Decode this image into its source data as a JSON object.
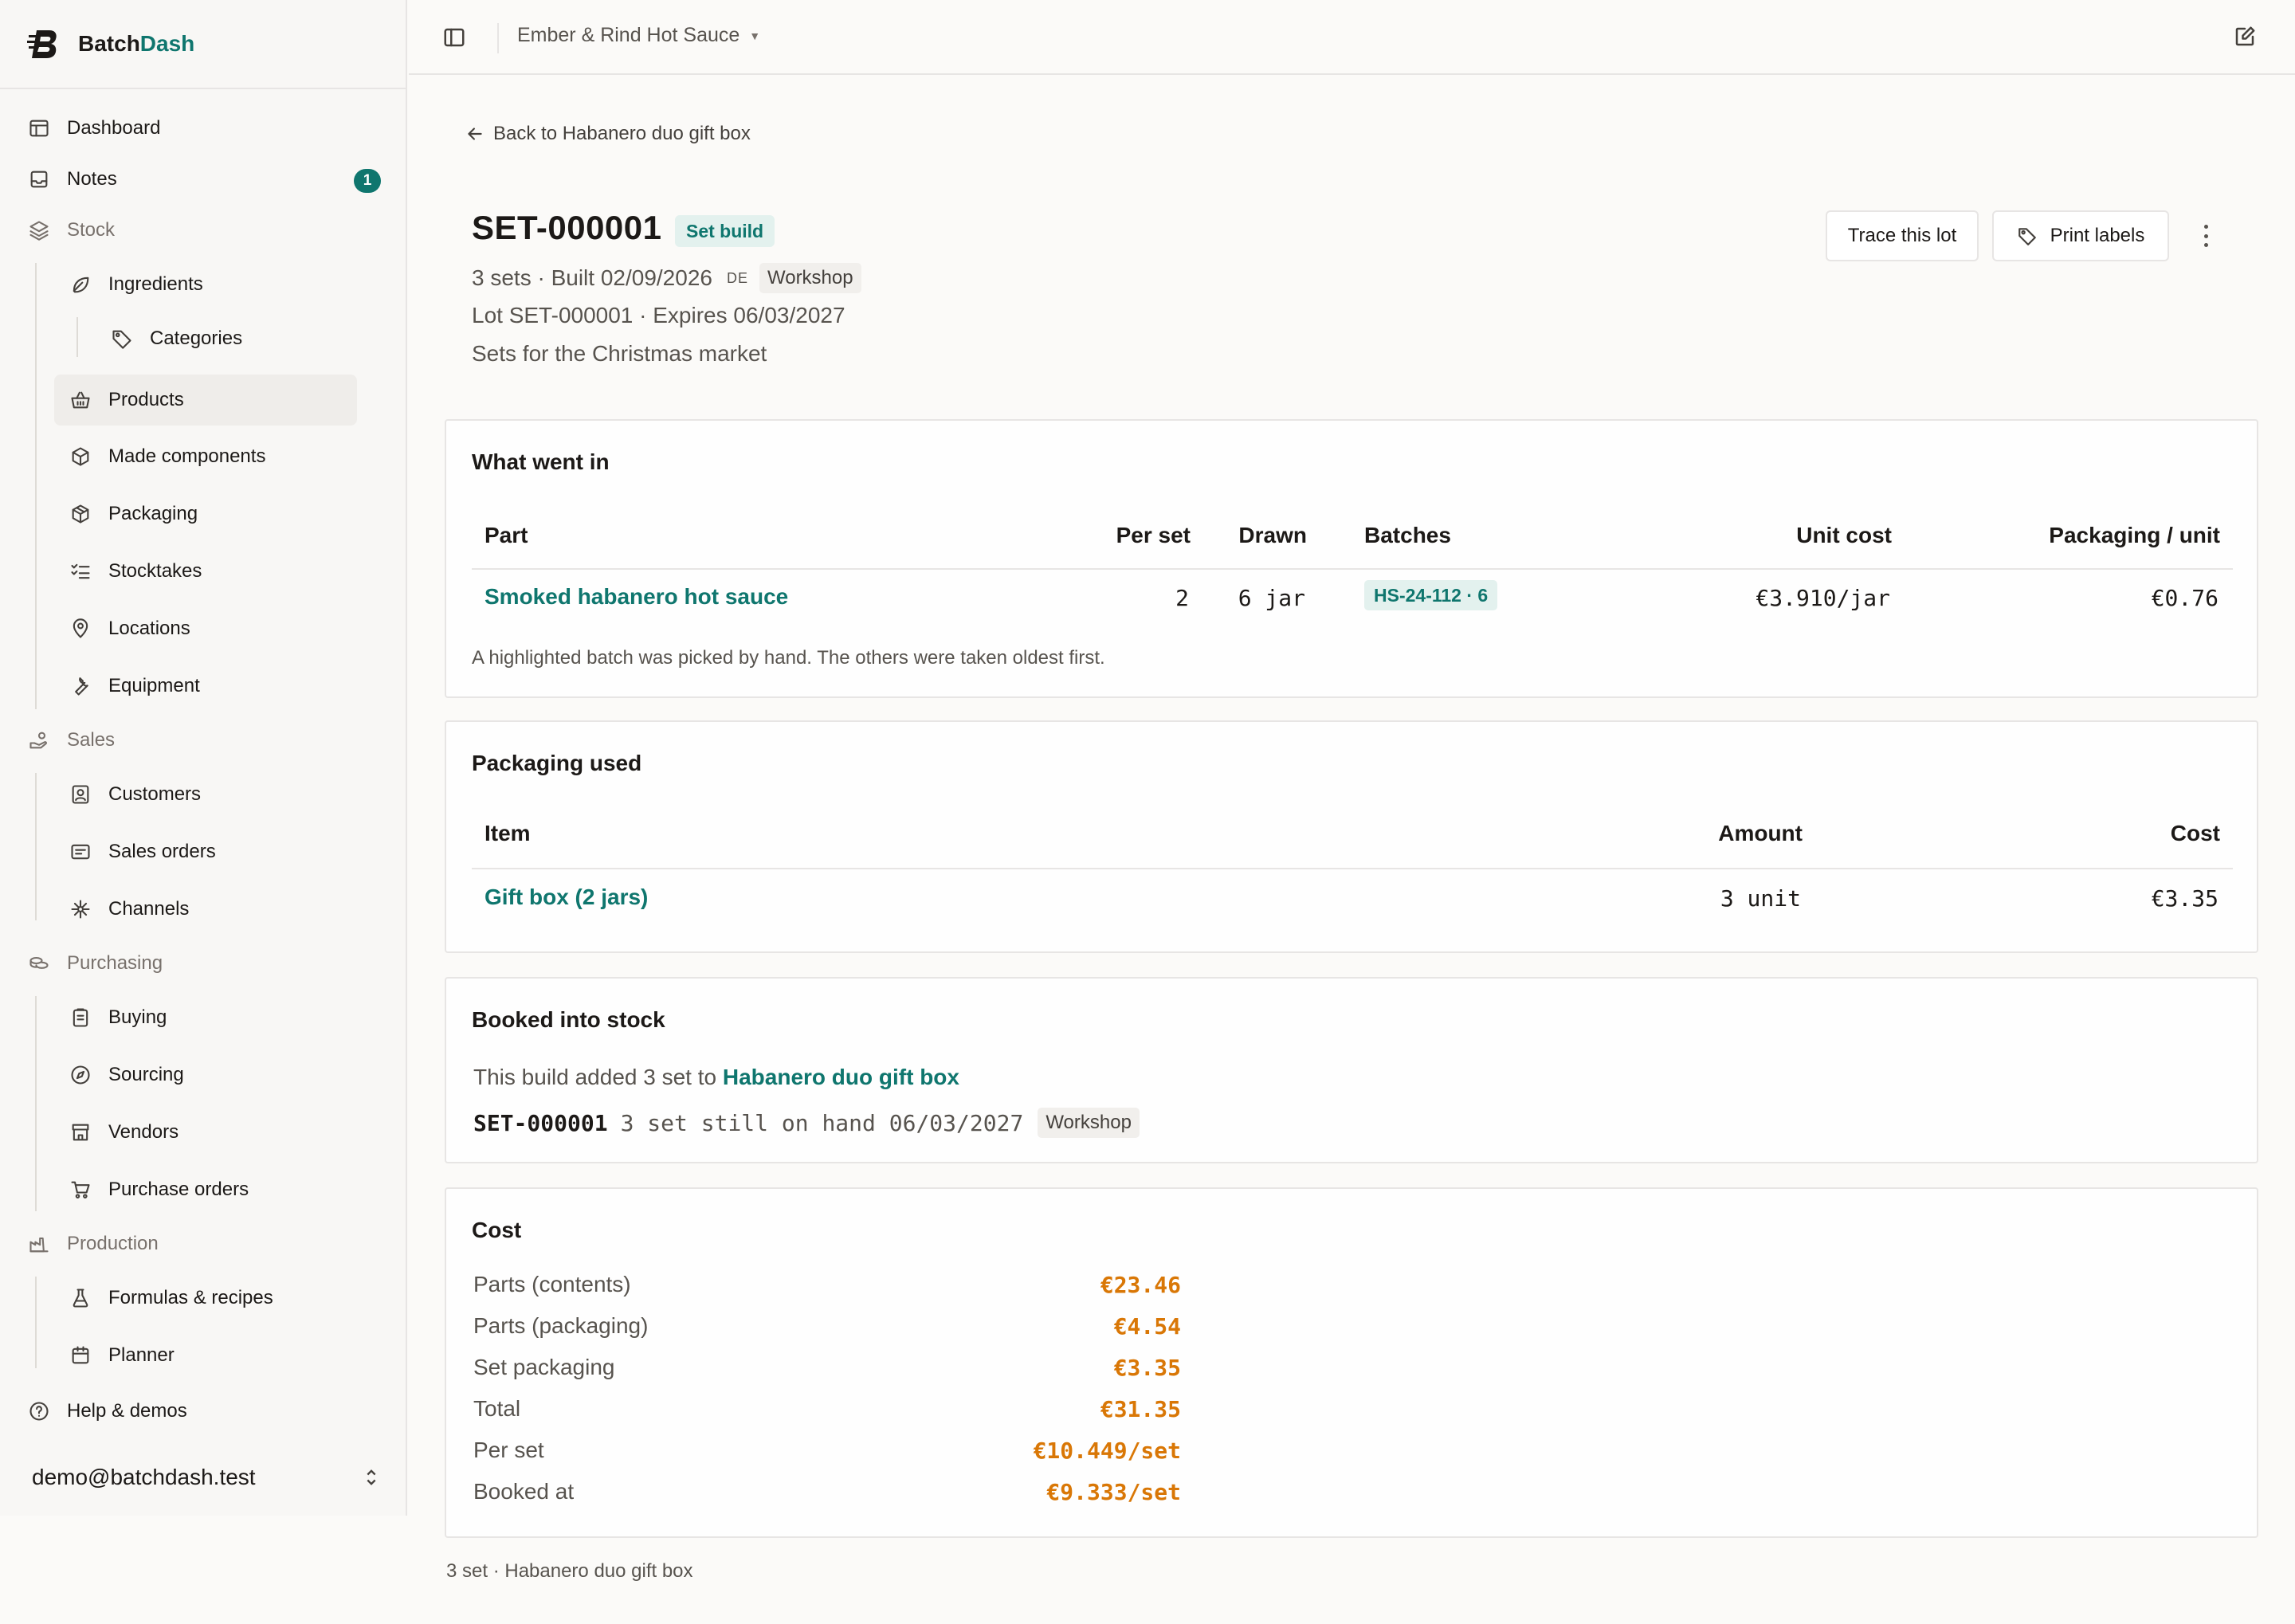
{
  "app": {
    "name_part1": "Batch",
    "name_part2": "Dash"
  },
  "sidebar": {
    "dashboard": "Dashboard",
    "notes": "Notes",
    "notes_count": "1",
    "stock": "Stock",
    "ingredients": "Ingredients",
    "categories": "Categories",
    "products": "Products",
    "made_components": "Made components",
    "packaging": "Packaging",
    "stocktakes": "Stocktakes",
    "locations": "Locations",
    "equipment": "Equipment",
    "sales": "Sales",
    "customers": "Customers",
    "sales_orders": "Sales orders",
    "channels": "Channels",
    "purchasing": "Purchasing",
    "buying": "Buying",
    "sourcing": "Sourcing",
    "vendors": "Vendors",
    "purchase_orders": "Purchase orders",
    "production": "Production",
    "formulas": "Formulas & recipes",
    "planner": "Planner",
    "help": "Help & demos",
    "user_email": "demo@batchdash.test"
  },
  "topbar": {
    "workspace": "Ember & Rind Hot Sauce"
  },
  "page": {
    "back_label": "Back to Habanero duo gift box",
    "title": "SET-000001",
    "type_badge": "Set build",
    "meta_sets": "3 sets · Built 02/09/2026",
    "meta_region": "DE",
    "meta_location": "Workshop",
    "meta_lot": "Lot SET-000001 · Expires 06/03/2027",
    "meta_note": "Sets for the Christmas market",
    "actions": {
      "trace": "Trace this lot",
      "print": "Print labels"
    }
  },
  "what_went_in": {
    "title": "What went in",
    "headers": {
      "part": "Part",
      "per_set": "Per set",
      "drawn": "Drawn",
      "batches": "Batches",
      "unit_cost": "Unit cost",
      "packaging_unit": "Packaging / unit"
    },
    "rows": [
      {
        "part": "Smoked habanero hot sauce",
        "per_set": "2",
        "drawn": "6 jar",
        "batch": "HS-24-112 · 6",
        "unit_cost": "€3.910/jar",
        "packaging_unit": "€0.76"
      }
    ],
    "note": "A highlighted batch was picked by hand. The others were taken oldest first."
  },
  "packaging_used": {
    "title": "Packaging used",
    "headers": {
      "item": "Item",
      "amount": "Amount",
      "cost": "Cost"
    },
    "rows": [
      {
        "item": "Gift box (2 jars)",
        "amount": "3 unit",
        "cost": "€3.35"
      }
    ]
  },
  "booked": {
    "title": "Booked into stock",
    "text": "This build added 3 set to",
    "product": "Habanero duo gift box",
    "lot": "SET-000001",
    "on_hand": "3 set still on hand 06/03/2027",
    "location": "Workshop"
  },
  "cost": {
    "title": "Cost",
    "lines": [
      {
        "label": "Parts (contents)",
        "value": "€23.46"
      },
      {
        "label": "Parts (packaging)",
        "value": "€4.54"
      },
      {
        "label": "Set packaging",
        "value": "€3.35"
      },
      {
        "label": "Total",
        "value": "€31.35"
      },
      {
        "label": "Per set",
        "value": "€10.449/set"
      },
      {
        "label": "Booked at",
        "value": "€9.333/set"
      }
    ]
  },
  "footer": "3 set · Habanero duo gift box"
}
